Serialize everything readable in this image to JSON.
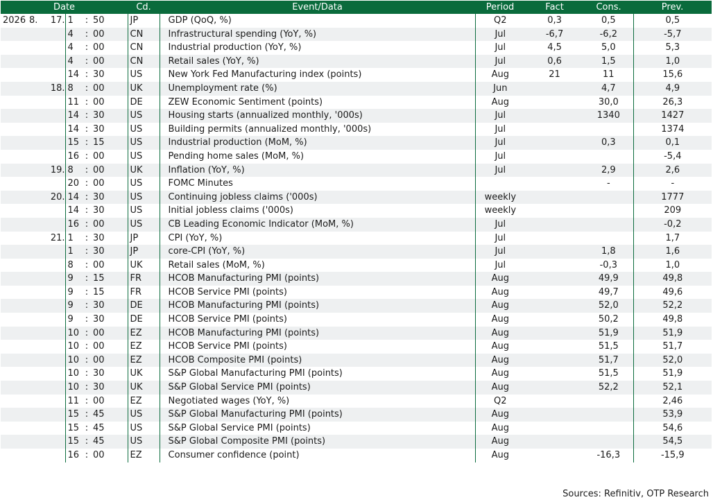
{
  "headers": {
    "date": "Date",
    "cd": "Cd.",
    "event": "Event/Data",
    "period": "Period",
    "fact": "Fact",
    "cons": "Cons.",
    "prev": "Prev."
  },
  "rows": [
    {
      "year": "2026",
      "month": "8.",
      "day": "17.",
      "hour": "1",
      "min": "50",
      "cd": "JP",
      "event": "GDP (QoQ, %)",
      "period": "Q2",
      "fact": "0,3",
      "cons": "0,5",
      "prev": "0,5"
    },
    {
      "year": "",
      "month": "",
      "day": "",
      "hour": "4",
      "min": "00",
      "cd": "CN",
      "event": "Infrastructural spending (YoY, %)",
      "period": "Jul",
      "fact": "-6,7",
      "cons": "-6,2",
      "prev": "-5,7"
    },
    {
      "year": "",
      "month": "",
      "day": "",
      "hour": "4",
      "min": "00",
      "cd": "CN",
      "event": "Industrial production (YoY, %)",
      "period": "Jul",
      "fact": "4,5",
      "cons": "5,0",
      "prev": "5,3"
    },
    {
      "year": "",
      "month": "",
      "day": "",
      "hour": "4",
      "min": "00",
      "cd": "CN",
      "event": "Retail sales (YoY, %)",
      "period": "Jul",
      "fact": "0,6",
      "cons": "1,5",
      "prev": "1,0"
    },
    {
      "year": "",
      "month": "",
      "day": "",
      "hour": "14",
      "min": "30",
      "cd": "US",
      "event": "New York Fed Manufacturing index (points)",
      "period": "Aug",
      "fact": "21",
      "cons": "11",
      "prev": "15,6"
    },
    {
      "year": "",
      "month": "",
      "day": "18.",
      "hour": "8",
      "min": "00",
      "cd": "UK",
      "event": "Unemployment rate (%)",
      "period": "Jun",
      "fact": "",
      "cons": "4,7",
      "prev": "4,9"
    },
    {
      "year": "",
      "month": "",
      "day": "",
      "hour": "11",
      "min": "00",
      "cd": "DE",
      "event": "ZEW Economic Sentiment (points)",
      "period": "Aug",
      "fact": "",
      "cons": "30,0",
      "prev": "26,3"
    },
    {
      "year": "",
      "month": "",
      "day": "",
      "hour": "14",
      "min": "30",
      "cd": "US",
      "event": "Housing starts (annualized monthly, '000s)",
      "period": "Jul",
      "fact": "",
      "cons": "1340",
      "prev": "1427"
    },
    {
      "year": "",
      "month": "",
      "day": "",
      "hour": "14",
      "min": "30",
      "cd": "US",
      "event": "Building permits (annualized monthly, '000s)",
      "period": "Jul",
      "fact": "",
      "cons": "",
      "prev": "1374"
    },
    {
      "year": "",
      "month": "",
      "day": "",
      "hour": "15",
      "min": "15",
      "cd": "US",
      "event": "Industrial production (MoM, %)",
      "period": "Jul",
      "fact": "",
      "cons": "0,3",
      "prev": "0,1"
    },
    {
      "year": "",
      "month": "",
      "day": "",
      "hour": "16",
      "min": "00",
      "cd": "US",
      "event": "Pending home sales (MoM, %)",
      "period": "Jul",
      "fact": "",
      "cons": "",
      "prev": "-5,4"
    },
    {
      "year": "",
      "month": "",
      "day": "19.",
      "hour": "8",
      "min": "00",
      "cd": "UK",
      "event": "Inflation (YoY, %)",
      "period": "Jul",
      "fact": "",
      "cons": "2,9",
      "prev": "2,6"
    },
    {
      "year": "",
      "month": "",
      "day": "",
      "hour": "20",
      "min": "00",
      "cd": "US",
      "event": "FOMC Minutes",
      "period": "",
      "fact": "",
      "cons": "-",
      "prev": "-"
    },
    {
      "year": "",
      "month": "",
      "day": "20.",
      "hour": "14",
      "min": "30",
      "cd": "US",
      "event": "Continuing jobless claims ('000s)",
      "period": "weekly",
      "fact": "",
      "cons": "",
      "prev": "1777"
    },
    {
      "year": "",
      "month": "",
      "day": "",
      "hour": "14",
      "min": "30",
      "cd": "US",
      "event": "Initial jobless claims ('000s)",
      "period": "weekly",
      "fact": "",
      "cons": "",
      "prev": "209"
    },
    {
      "year": "",
      "month": "",
      "day": "",
      "hour": "16",
      "min": "00",
      "cd": "US",
      "event": "CB Leading Economic Indicator (MoM, %)",
      "period": "Jul",
      "fact": "",
      "cons": "",
      "prev": "-0,2"
    },
    {
      "year": "",
      "month": "",
      "day": "21.",
      "hour": "1",
      "min": "30",
      "cd": "JP",
      "event": "CPI (YoY, %)",
      "period": "Jul",
      "fact": "",
      "cons": "",
      "prev": "1,7"
    },
    {
      "year": "",
      "month": "",
      "day": "",
      "hour": "1",
      "min": "30",
      "cd": "JP",
      "event": "core-CPI (YoY, %)",
      "period": "Jul",
      "fact": "",
      "cons": "1,8",
      "prev": "1,6"
    },
    {
      "year": "",
      "month": "",
      "day": "",
      "hour": "8",
      "min": "00",
      "cd": "UK",
      "event": "Retail sales (MoM, %)",
      "period": "Jul",
      "fact": "",
      "cons": "-0,3",
      "prev": "1,0"
    },
    {
      "year": "",
      "month": "",
      "day": "",
      "hour": "9",
      "min": "15",
      "cd": "FR",
      "event": "HCOB Manufacturing PMI (points)",
      "period": "Aug",
      "fact": "",
      "cons": "49,9",
      "prev": "49,8"
    },
    {
      "year": "",
      "month": "",
      "day": "",
      "hour": "9",
      "min": "15",
      "cd": "FR",
      "event": "HCOB Service PMI (points)",
      "period": "Aug",
      "fact": "",
      "cons": "49,7",
      "prev": "49,6"
    },
    {
      "year": "",
      "month": "",
      "day": "",
      "hour": "9",
      "min": "30",
      "cd": "DE",
      "event": "HCOB Manufacturing PMI (points)",
      "period": "Aug",
      "fact": "",
      "cons": "52,0",
      "prev": "52,2"
    },
    {
      "year": "",
      "month": "",
      "day": "",
      "hour": "9",
      "min": "30",
      "cd": "DE",
      "event": "HCOB Service PMI (points)",
      "period": "Aug",
      "fact": "",
      "cons": "50,2",
      "prev": "49,8"
    },
    {
      "year": "",
      "month": "",
      "day": "",
      "hour": "10",
      "min": "00",
      "cd": "EZ",
      "event": "HCOB Manufacturing PMI (points)",
      "period": "Aug",
      "fact": "",
      "cons": "51,9",
      "prev": "51,9"
    },
    {
      "year": "",
      "month": "",
      "day": "",
      "hour": "10",
      "min": "00",
      "cd": "EZ",
      "event": "HCOB Service PMI (points)",
      "period": "Aug",
      "fact": "",
      "cons": "51,5",
      "prev": "51,7"
    },
    {
      "year": "",
      "month": "",
      "day": "",
      "hour": "10",
      "min": "00",
      "cd": "EZ",
      "event": "HCOB Composite PMI (points)",
      "period": "Aug",
      "fact": "",
      "cons": "51,7",
      "prev": "52,0"
    },
    {
      "year": "",
      "month": "",
      "day": "",
      "hour": "10",
      "min": "30",
      "cd": "UK",
      "event": "S&P Global Manufacturing PMI (points)",
      "period": "Aug",
      "fact": "",
      "cons": "51,5",
      "prev": "51,9"
    },
    {
      "year": "",
      "month": "",
      "day": "",
      "hour": "10",
      "min": "30",
      "cd": "UK",
      "event": "S&P Global Service PMI (points)",
      "period": "Aug",
      "fact": "",
      "cons": "52,2",
      "prev": "52,1"
    },
    {
      "year": "",
      "month": "",
      "day": "",
      "hour": "11",
      "min": "00",
      "cd": "EZ",
      "event": "Negotiated wages (YoY, %)",
      "period": "Q2",
      "fact": "",
      "cons": "",
      "prev": "2,46"
    },
    {
      "year": "",
      "month": "",
      "day": "",
      "hour": "15",
      "min": "45",
      "cd": "US",
      "event": "S&P Global Manufacturing PMI (points)",
      "period": "Aug",
      "fact": "",
      "cons": "",
      "prev": "53,9"
    },
    {
      "year": "",
      "month": "",
      "day": "",
      "hour": "15",
      "min": "45",
      "cd": "US",
      "event": "S&P Global Service PMI (points)",
      "period": "Aug",
      "fact": "",
      "cons": "",
      "prev": "54,6"
    },
    {
      "year": "",
      "month": "",
      "day": "",
      "hour": "15",
      "min": "45",
      "cd": "US",
      "event": "S&P Global Composite PMI (points)",
      "period": "Aug",
      "fact": "",
      "cons": "",
      "prev": "54,5"
    },
    {
      "year": "",
      "month": "",
      "day": "",
      "hour": "16",
      "min": "00",
      "cd": "EZ",
      "event": "Consumer confidence (point)",
      "period": "Aug",
      "fact": "",
      "cons": "-16,3",
      "prev": "-15,9"
    }
  ],
  "source": "Sources: Refinitiv, OTP Research"
}
